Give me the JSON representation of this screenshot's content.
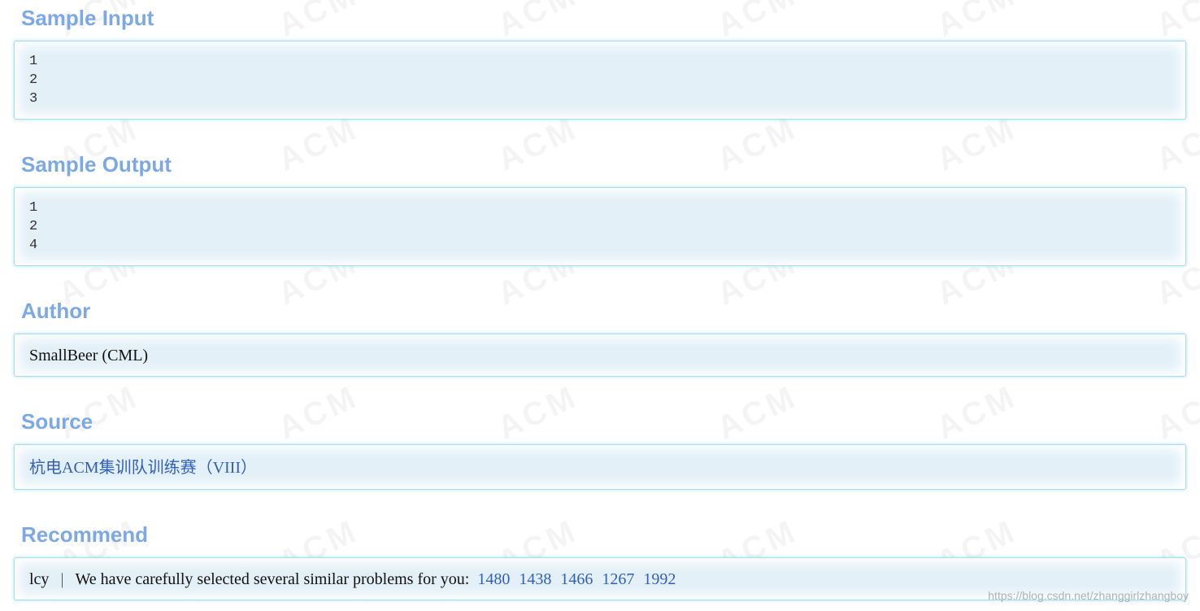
{
  "watermark": {
    "text": "ACM",
    "url": "https://blog.csdn.net/zhanggirlzhangboy"
  },
  "sample_input": {
    "title": "Sample Input",
    "lines": [
      "1",
      "2",
      "3"
    ]
  },
  "sample_output": {
    "title": "Sample Output",
    "lines": [
      "1",
      "2",
      "4"
    ]
  },
  "author": {
    "title": "Author",
    "value": "SmallBeer (CML)"
  },
  "source": {
    "title": "Source",
    "value": "杭电ACM集训队训练赛（VIII）"
  },
  "recommend": {
    "title": "Recommend",
    "user": "lcy",
    "separator": "|",
    "message": "We have carefully selected several similar problems for you:",
    "problem_ids": [
      "1480",
      "1438",
      "1466",
      "1267",
      "1992"
    ]
  },
  "colors": {
    "heading": "#7ca9e6",
    "panel_bg": "#e3f0f8",
    "panel_border": "#a8dcef",
    "link": "#2f5fbf"
  }
}
